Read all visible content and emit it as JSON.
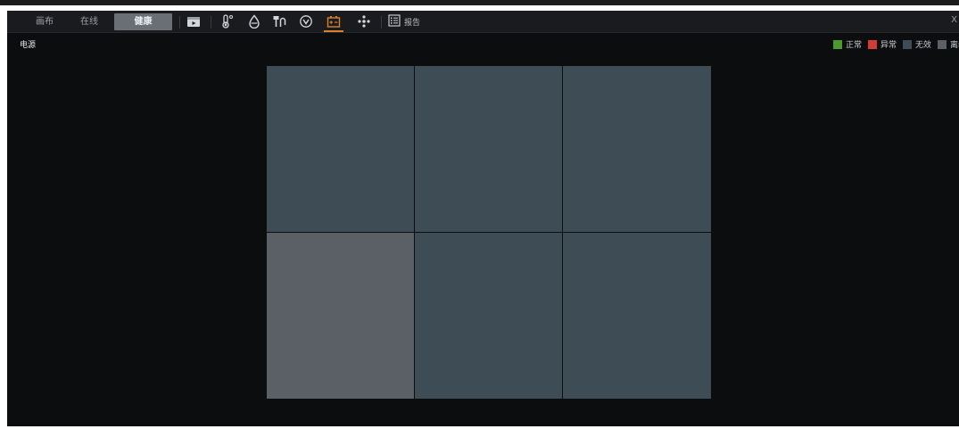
{
  "toolbar": {
    "tabs": [
      {
        "label": "画布",
        "active": false
      },
      {
        "label": "在线",
        "active": false
      },
      {
        "label": "健康",
        "active": true
      }
    ],
    "icons": [
      {
        "name": "screen-display-icon",
        "active": false
      },
      {
        "name": "thermometer-icon",
        "active": false
      },
      {
        "name": "humidity-drop-icon",
        "active": false
      },
      {
        "name": "plug-icon",
        "active": false
      },
      {
        "name": "voltage-icon",
        "active": false
      },
      {
        "name": "battery-power-icon",
        "active": true
      },
      {
        "name": "fan-icon",
        "active": false
      }
    ],
    "report_label": "报告",
    "close_label": "X"
  },
  "section": {
    "title": "电源"
  },
  "legend": [
    {
      "label": "正常",
      "color": "#4a9a2e"
    },
    {
      "label": "异常",
      "color": "#d23b36"
    },
    {
      "label": "无效",
      "color": "#3d4c55"
    },
    {
      "label": "离线",
      "color": "#5b5f66"
    }
  ],
  "cells": [
    {
      "status": "无效",
      "color": "#3d4c55"
    },
    {
      "status": "无效",
      "color": "#3d4c55"
    },
    {
      "status": "无效",
      "color": "#3d4c55"
    },
    {
      "status": "离线",
      "color": "#5b5f66"
    },
    {
      "status": "无效",
      "color": "#3d4c55"
    },
    {
      "status": "无效",
      "color": "#3d4c55"
    }
  ],
  "colors": {
    "accent": "#d9822b",
    "background": "#0c0d0f"
  }
}
